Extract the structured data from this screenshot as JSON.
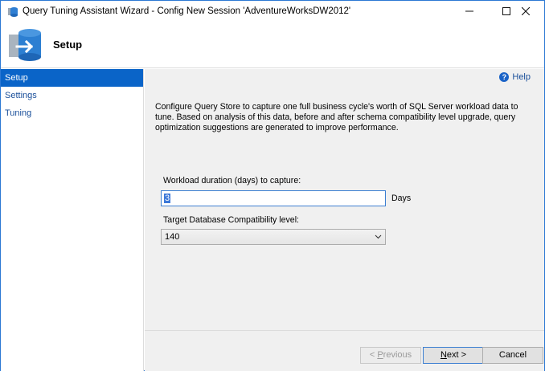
{
  "window": {
    "title": "Query Tuning Assistant Wizard - Config New Session 'AdventureWorksDW2012'",
    "minimize_glyph": "—",
    "maximize_glyph": "☐",
    "close_glyph": "✕"
  },
  "banner": {
    "title": "Setup"
  },
  "sidebar": {
    "items": [
      {
        "label": "Setup",
        "active": true
      },
      {
        "label": "Settings",
        "active": false
      },
      {
        "label": "Tuning",
        "active": false
      }
    ]
  },
  "main": {
    "help_label": "Help",
    "description": "Configure Query Store to capture one full business cycle's worth of SQL Server workload data to tune. Based on analysis of this data, before and after schema compatibility level upgrade, query optimization suggestions are generated to improve performance.",
    "duration_label": "Workload duration (days) to capture:",
    "duration_value": "3",
    "duration_unit": "Days",
    "compat_label": "Target Database Compatibility level:",
    "compat_value": "140"
  },
  "footer": {
    "previous_prefix": "< ",
    "previous_key": "P",
    "previous_rest": "revious",
    "next_key": "N",
    "next_rest": "ext >",
    "cancel_label": "Cancel"
  },
  "colors": {
    "accent": "#0a64c8",
    "link": "#1a4f9a",
    "content_bg": "#f0f0f0"
  },
  "icons": {
    "app": "sql-database-icon",
    "banner": "database-arrow-icon",
    "help": "help-circle-icon",
    "dropdown": "chevron-down-icon"
  }
}
